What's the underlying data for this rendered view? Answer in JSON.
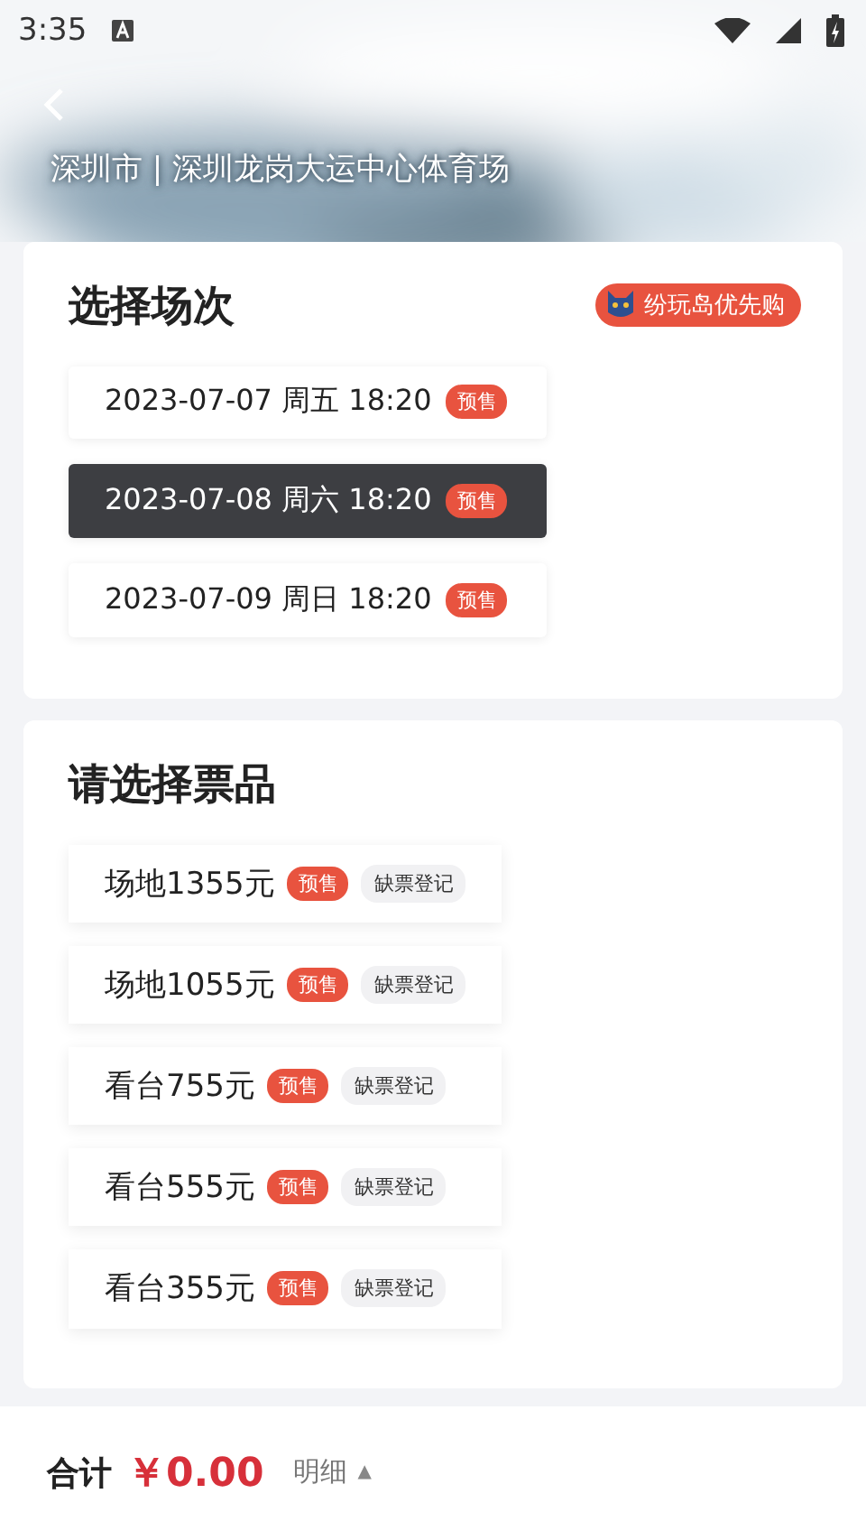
{
  "status_bar": {
    "time": "3:35"
  },
  "header": {
    "venue": "深圳市 | 深圳龙岗大运中心体育场"
  },
  "sessions": {
    "title": "选择场次",
    "promo": "纷玩岛优先购",
    "items": [
      {
        "label": "2023-07-07 周五 18:20",
        "tag": "预售",
        "selected": false
      },
      {
        "label": "2023-07-08 周六 18:20",
        "tag": "预售",
        "selected": true
      },
      {
        "label": "2023-07-09 周日 18:20",
        "tag": "预售",
        "selected": false
      }
    ]
  },
  "tickets": {
    "title": "请选择票品",
    "items": [
      {
        "label": "场地1355元",
        "tag": "预售",
        "action": "缺票登记"
      },
      {
        "label": "场地1055元",
        "tag": "预售",
        "action": "缺票登记"
      },
      {
        "label": "看台755元",
        "tag": "预售",
        "action": "缺票登记"
      },
      {
        "label": "看台555元",
        "tag": "预售",
        "action": "缺票登记"
      },
      {
        "label": "看台355元",
        "tag": "预售",
        "action": "缺票登记"
      }
    ]
  },
  "footer": {
    "total_label": "合计",
    "total": "￥0.00",
    "detail": "明细",
    "detail_caret": "▲"
  }
}
